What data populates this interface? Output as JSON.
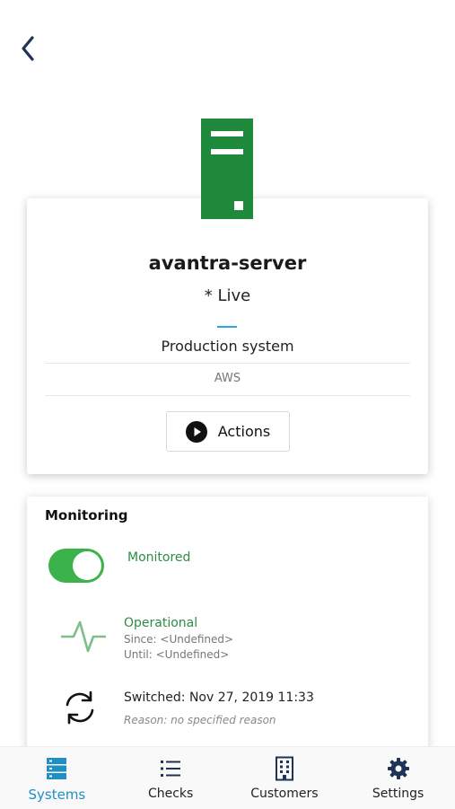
{
  "header": {
    "back_icon": "chevron-left-icon"
  },
  "system": {
    "icon": "server-icon",
    "icon_color": "#208a3c",
    "name": "avantra-server",
    "status": "* Live",
    "role": "Production system",
    "host": "AWS",
    "actions_label": "Actions",
    "actions_icon": "play-circle-icon"
  },
  "monitoring": {
    "title": "Monitoring",
    "monitored_label": "Monitored",
    "monitored_on": true,
    "operational": {
      "title": "Operational",
      "since": "Since: <Undefined>",
      "until": "Until: <Undefined>",
      "icon": "pulse-icon"
    },
    "switched": {
      "text": "Switched: Nov 27, 2019 11:33",
      "reason": "Reason: no specified reason",
      "icon": "refresh-icon"
    }
  },
  "nav": {
    "items": [
      {
        "label": "Systems",
        "icon": "systems-icon",
        "active": true
      },
      {
        "label": "Checks",
        "icon": "list-icon",
        "active": false
      },
      {
        "label": "Customers",
        "icon": "building-icon",
        "active": false
      },
      {
        "label": "Settings",
        "icon": "gear-icon",
        "active": false
      }
    ]
  },
  "colors": {
    "accent": "#1f8fc4",
    "green": "#3cb24a",
    "navy": "#1e3355"
  }
}
